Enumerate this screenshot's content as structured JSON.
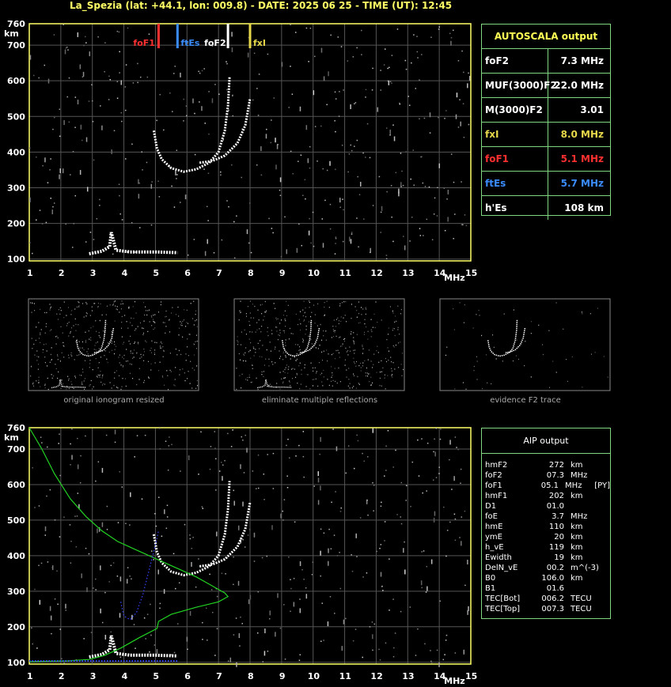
{
  "title": "La_Spezia (lat: +44.1, lon: 009.8) - DATE: 2025 06 25 - TIME (UT): 12:45",
  "colors": {
    "frame": "#ffff66",
    "grid": "#555555",
    "panel_border": "#7fd87f",
    "foF1": "#ff3030",
    "ftEs": "#3a8cff",
    "fxI": "#e6d84a",
    "foF2": "#ffffff",
    "profile": "#22d422",
    "aip_trace": "#3344ff"
  },
  "chart_data": [
    {
      "type": "scatter",
      "title": "",
      "xlabel": "MHz",
      "ylabel": "km",
      "xlim": [
        1,
        15
      ],
      "ylim": [
        95,
        760
      ],
      "x_ticks": [
        "1",
        "2",
        "3",
        "4",
        "5",
        "6",
        "7",
        "8",
        "9",
        "10",
        "11",
        "12",
        "13",
        "14",
        "15"
      ],
      "y_ticks": [
        "100",
        "200",
        "300",
        "400",
        "500",
        "600",
        "700",
        "760"
      ],
      "grid": true,
      "markers": [
        {
          "label": "foF1",
          "freq": 5.1,
          "color": "#ff3030"
        },
        {
          "label": "ftEs",
          "freq": 5.7,
          "color": "#3a8cff"
        },
        {
          "label": "foF2",
          "freq": 7.3,
          "color": "#ffffff"
        },
        {
          "label": "fxI",
          "freq": 8.0,
          "color": "#e6d84a"
        }
      ],
      "traces": {
        "o_trace": [
          [
            4.95,
            460
          ],
          [
            5.05,
            410
          ],
          [
            5.2,
            380
          ],
          [
            5.5,
            355
          ],
          [
            5.9,
            345
          ],
          [
            6.3,
            352
          ],
          [
            6.7,
            370
          ],
          [
            7.0,
            400
          ],
          [
            7.2,
            460
          ],
          [
            7.3,
            530
          ],
          [
            7.35,
            610
          ]
        ],
        "x_trace": [
          [
            6.4,
            370
          ],
          [
            6.8,
            375
          ],
          [
            7.2,
            390
          ],
          [
            7.6,
            425
          ],
          [
            7.85,
            475
          ],
          [
            8.0,
            550
          ]
        ],
        "es_trace": [
          [
            2.9,
            115
          ],
          [
            3.3,
            122
          ],
          [
            3.55,
            135
          ],
          [
            3.6,
            175
          ],
          [
            3.75,
            125
          ],
          [
            4.2,
            120
          ],
          [
            5.0,
            120
          ],
          [
            5.7,
            118
          ]
        ]
      }
    },
    {
      "type": "line",
      "title": "",
      "xlabel": "MHz",
      "ylabel": "km",
      "xlim": [
        1,
        15
      ],
      "ylim": [
        95,
        760
      ],
      "x_ticks": [
        "1",
        "2",
        "3",
        "4",
        "5",
        "6",
        "7",
        "8",
        "9",
        "10",
        "11",
        "12",
        "13",
        "14",
        "15"
      ],
      "y_ticks": [
        "100",
        "200",
        "300",
        "400",
        "500",
        "600",
        "700",
        "760"
      ],
      "grid": true,
      "series": [
        {
          "name": "",
          "color": "#22d422",
          "x": [
            1,
            1.4,
            1.8,
            2.3,
            2.8,
            3.3,
            3.8,
            4.3,
            4.8,
            5.3,
            5.8,
            6.3,
            6.8,
            7.2,
            7.3,
            7.0,
            6.3,
            5.5,
            5.1,
            5.05,
            4.5,
            3.9,
            3.4,
            2.9,
            2.2,
            1.0
          ],
          "y": [
            760,
            700,
            630,
            560,
            510,
            470,
            440,
            420,
            400,
            380,
            360,
            340,
            315,
            295,
            285,
            270,
            255,
            235,
            215,
            195,
            170,
            140,
            120,
            108,
            104,
            102
          ]
        },
        {
          "name": "",
          "color": "#3344ff",
          "x": [
            3.9,
            4.0,
            4.2,
            4.4,
            4.6,
            4.8,
            5.0,
            5.1
          ],
          "y": [
            270,
            230,
            220,
            240,
            290,
            360,
            430,
            470
          ]
        }
      ]
    }
  ],
  "thumbnails": [
    {
      "caption": "original ionogram resized"
    },
    {
      "caption": "eliminate multiple reflections"
    },
    {
      "caption": "evidence F2 trace"
    }
  ],
  "autoscala": {
    "header": "AUTOSCALA output",
    "rows": [
      {
        "key": "foF2",
        "value": "7.3 MHz",
        "color": "#ffffff"
      },
      {
        "key": "MUF(3000)F2",
        "value": "22.0 MHz",
        "color": "#ffffff"
      },
      {
        "key": "M(3000)F2",
        "value": "3.01",
        "color": "#ffffff"
      },
      {
        "key": "fxI",
        "value": "8.0 MHz",
        "color": "#e6d84a"
      },
      {
        "key": "foF1",
        "value": "5.1 MHz",
        "color": "#ff3030"
      },
      {
        "key": "ftEs",
        "value": "5.7 MHz",
        "color": "#3a8cff"
      },
      {
        "key": "h'Es",
        "value": "108     km",
        "color": "#ffffff"
      }
    ]
  },
  "aip": {
    "header": "AIP output",
    "rows": [
      {
        "k": "hmF2",
        "v": "272",
        "u": "km",
        "x": ""
      },
      {
        "k": "foF2",
        "v": "07.3",
        "u": "MHz",
        "x": ""
      },
      {
        "k": "foF1",
        "v": "05.1",
        "u": "MHz",
        "x": "[PY]"
      },
      {
        "k": "hmF1",
        "v": "202",
        "u": "km",
        "x": ""
      },
      {
        "k": "D1",
        "v": "01.0",
        "u": "",
        "x": ""
      },
      {
        "k": "foE",
        "v": "3.7",
        "u": "MHz",
        "x": ""
      },
      {
        "k": "hmE",
        "v": "110",
        "u": "km",
        "x": ""
      },
      {
        "k": "ymE",
        "v": "20",
        "u": "km",
        "x": ""
      },
      {
        "k": "h_vE",
        "v": "119",
        "u": "km",
        "x": ""
      },
      {
        "k": "Ewidth",
        "v": "19",
        "u": "km",
        "x": ""
      },
      {
        "k": "DelN_vE",
        "v": "00.2",
        "u": "m^(-3)",
        "x": ""
      },
      {
        "k": "B0",
        "v": "106.0",
        "u": "km",
        "x": ""
      },
      {
        "k": "B1",
        "v": "01.6",
        "u": "",
        "x": ""
      },
      {
        "k": "TEC[Bot]",
        "v": "006.2",
        "u": "TECU",
        "x": ""
      },
      {
        "k": "TEC[Top]",
        "v": "007.3",
        "u": "TECU",
        "x": ""
      }
    ]
  }
}
